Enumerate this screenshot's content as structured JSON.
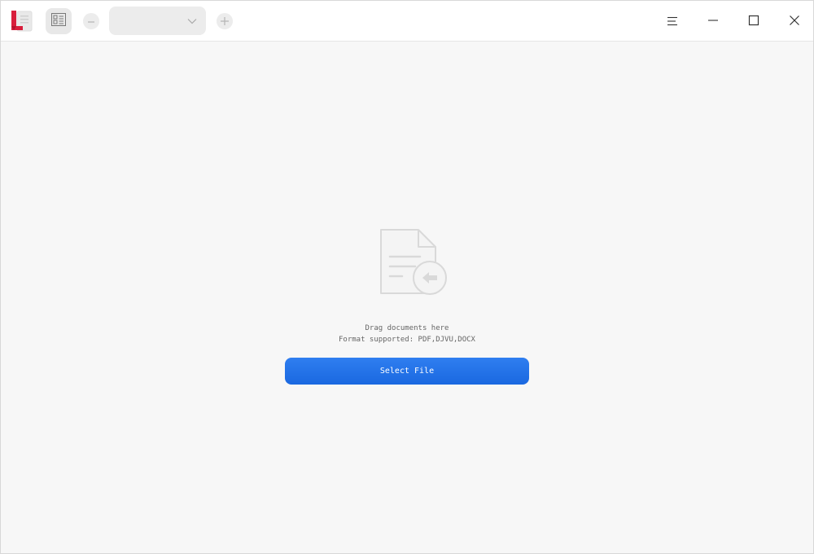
{
  "titlebar": {
    "logo_icon": "document-viewer-logo-icon",
    "sidebar_toggle_icon": "thumbnail-sidebar-icon",
    "zoom_out_icon": "minus-icon",
    "zoom_select": {
      "value": "",
      "arrow_icon": "chevron-down-icon"
    },
    "zoom_in_icon": "plus-icon",
    "menu_icon": "hamburger-menu-icon",
    "minimize_icon": "minimize-icon",
    "maximize_icon": "maximize-icon",
    "close_icon": "close-icon"
  },
  "empty_state": {
    "illustration_icon": "document-import-icon",
    "hint_drag": "Drag documents here",
    "hint_formats": "Format supported: PDF,DJVU,DOCX",
    "select_file_label": "Select File"
  },
  "colors": {
    "accent": "#2474e8",
    "background": "#f7f7f7",
    "titlebar": "#ffffff",
    "logo_red": "#d81e3c"
  }
}
